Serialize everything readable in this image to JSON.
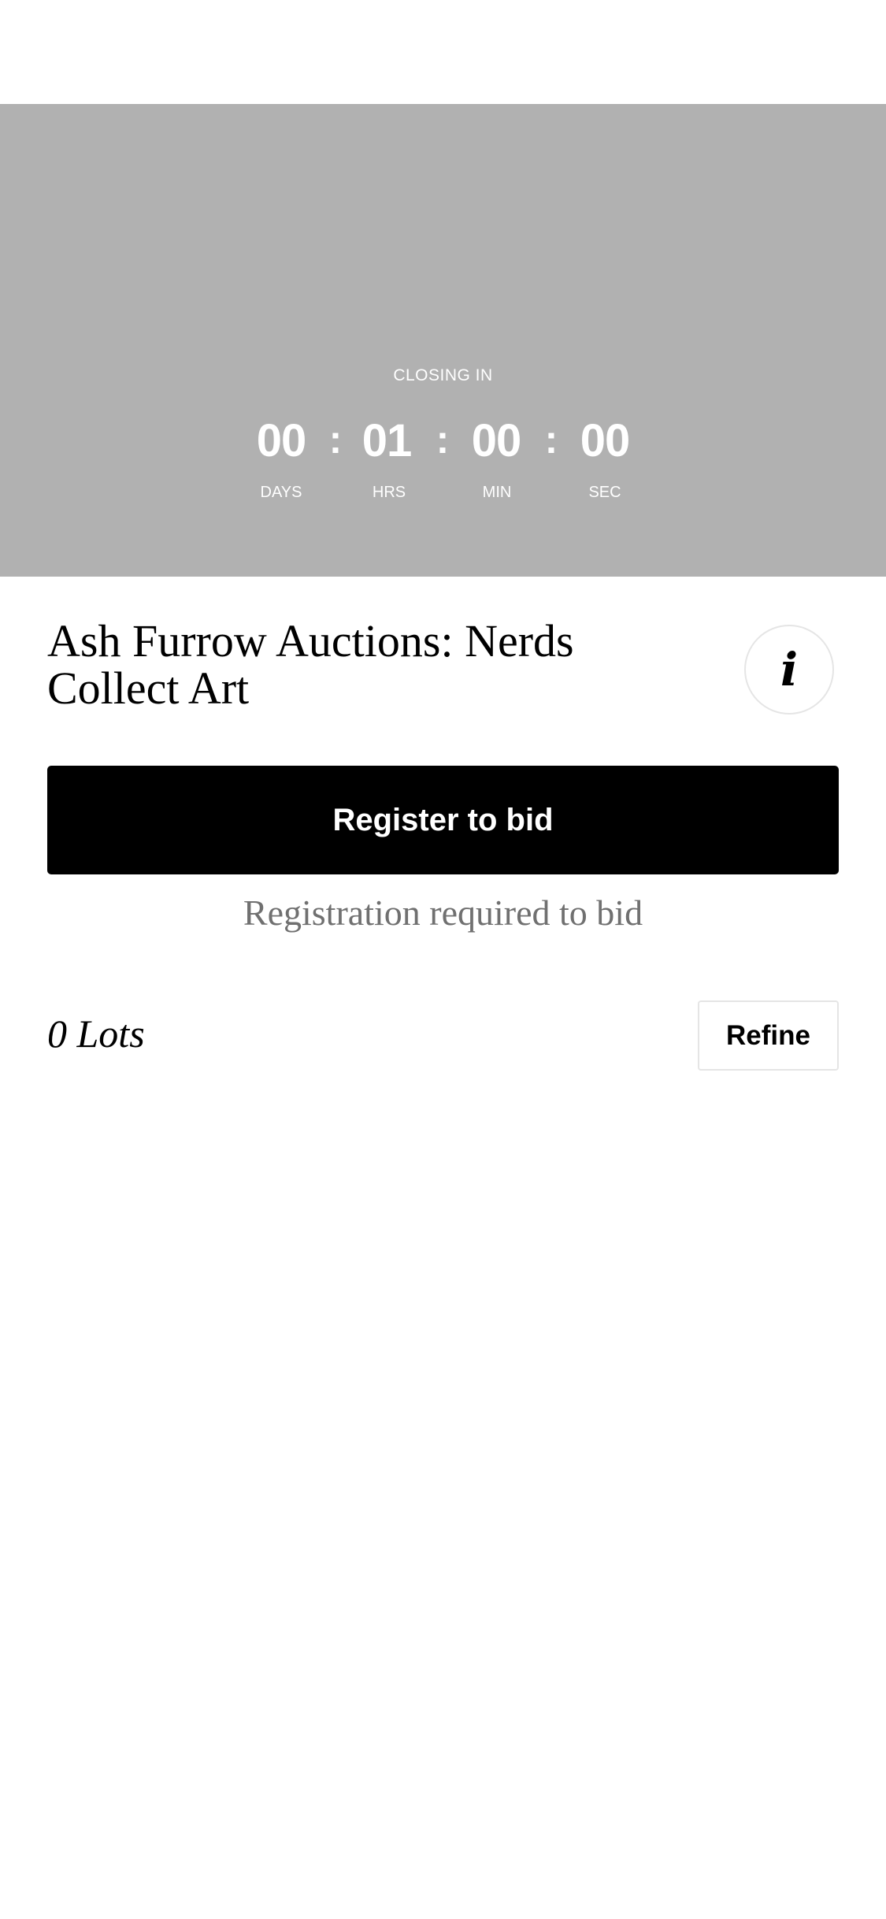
{
  "hero": {
    "background_color": "#b1b1b1",
    "closing_label": "CLOSING IN",
    "timer": {
      "days": "00",
      "hours": "01",
      "minutes": "00",
      "seconds": "00",
      "separator": ":",
      "labels": {
        "days": "DAYS",
        "hours": "HRS",
        "minutes": "MIN",
        "seconds": "SEC"
      }
    }
  },
  "sale": {
    "title": "Ash Furrow Auctions: Nerds Collect Art",
    "info_icon": "info-icon",
    "info_glyph": "i"
  },
  "registration": {
    "button_label": "Register to bid",
    "note": "Registration required to bid"
  },
  "lots": {
    "count_label": "0 Lots",
    "refine_label": "Refine"
  },
  "colors": {
    "primary": "#000000",
    "muted_text": "#707070",
    "border": "#e5e5e5"
  }
}
